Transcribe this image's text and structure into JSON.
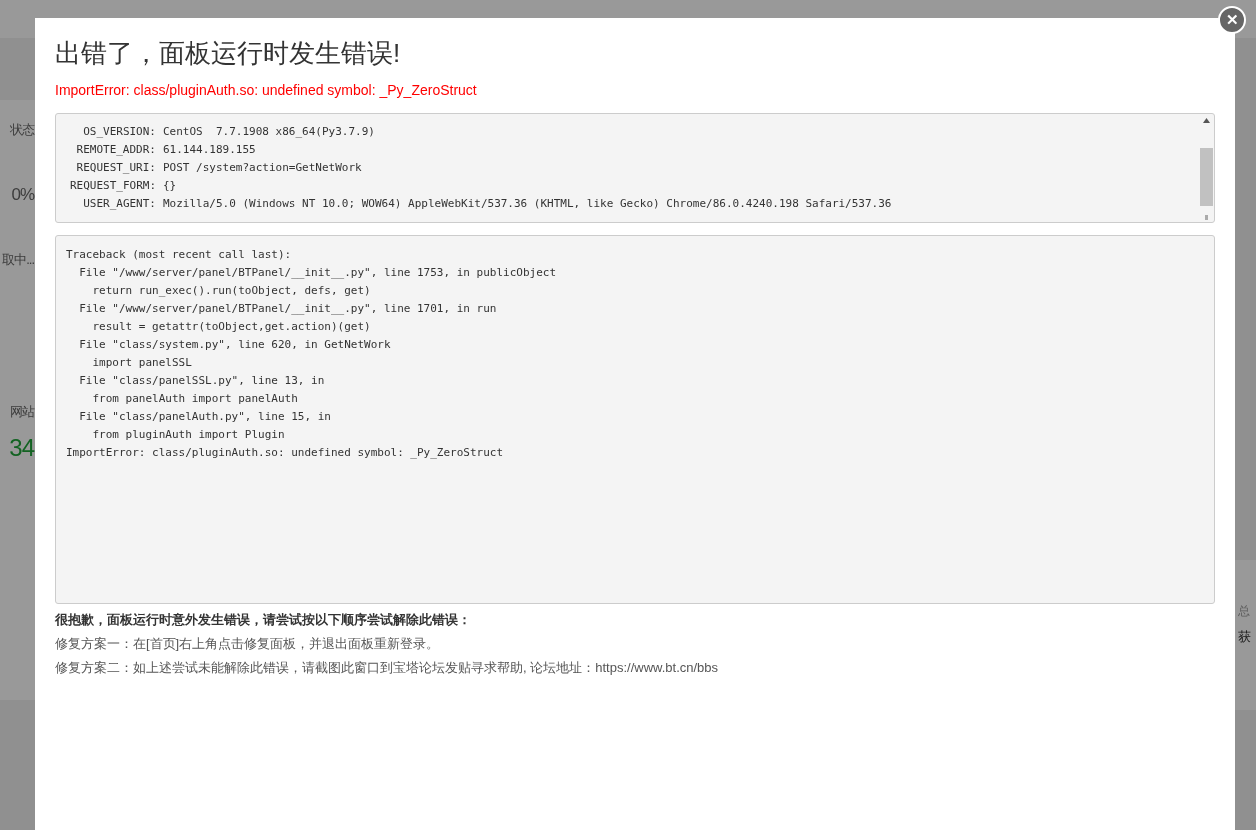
{
  "background_page": {
    "left_fragments": [
      {
        "kind": "label",
        "text": "状态"
      },
      {
        "kind": "value",
        "text": "0%"
      },
      {
        "kind": "label",
        "text": "取中..."
      },
      {
        "kind": "label",
        "text": "网站"
      },
      {
        "kind": "count",
        "text": "34"
      }
    ],
    "right_fragments": [
      {
        "kind": "label",
        "text": "总"
      },
      {
        "kind": "value",
        "text": "获"
      }
    ]
  },
  "dialog": {
    "title": "出错了，面板运行时发生错误!",
    "error": "ImportError: class/pluginAuth.so: undefined symbol: _Py_ZeroStruct",
    "info": [
      {
        "key": "OS_VERSION:",
        "value": "CentOS  7.7.1908 x86_64(Py3.7.9)"
      },
      {
        "key": "REMOTE_ADDR:",
        "value": "61.144.189.155"
      },
      {
        "key": "REQUEST_URI:",
        "value": "POST /system?action=GetNetWork"
      },
      {
        "key": "REQUEST_FORM:",
        "value": "{}"
      },
      {
        "key": "USER_AGENT:",
        "value": "Mozilla/5.0 (Windows NT 10.0; WOW64) AppleWebKit/537.36 (KHTML, like Gecko) Chrome/86.0.4240.198 Safari/537.36"
      }
    ],
    "traceback": [
      "Traceback (most recent call last):",
      "  File \"/www/server/panel/BTPanel/__init__.py\", line 1753, in publicObject",
      "    return run_exec().run(toObject, defs, get)",
      "  File \"/www/server/panel/BTPanel/__init__.py\", line 1701, in run",
      "    result = getattr(toObject,get.action)(get)",
      "  File \"class/system.py\", line 620, in GetNetWork",
      "    import panelSSL",
      "  File \"class/panelSSL.py\", line 13, in",
      "    from panelAuth import panelAuth",
      "  File \"class/panelAuth.py\", line 15, in",
      "    from pluginAuth import Plugin",
      "ImportError: class/pluginAuth.so: undefined symbol: _Py_ZeroStruct"
    ],
    "help_title": "很抱歉，面板运行时意外发生错误，请尝试按以下顺序尝试解除此错误：",
    "help_steps": [
      "修复方案一：在[首页]右上角点击修复面板，并退出面板重新登录。",
      "修复方案二：如上述尝试未能解除此错误，请截图此窗口到宝塔论坛发贴寻求帮助, 论坛地址：https://www.bt.cn/bbs"
    ],
    "close": "✕"
  }
}
